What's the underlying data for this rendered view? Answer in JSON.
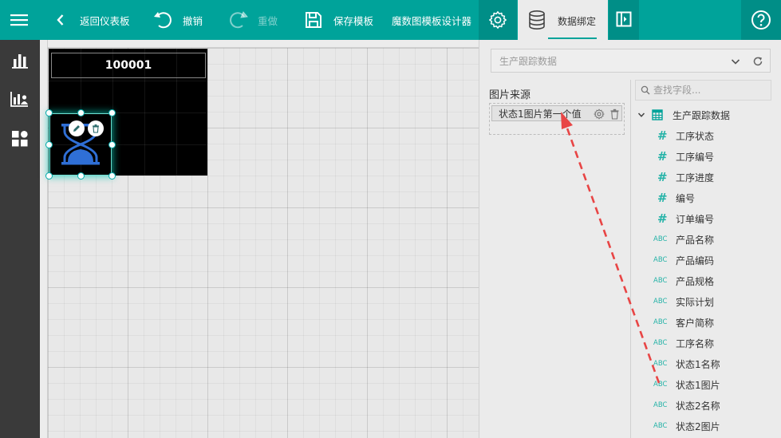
{
  "toolbar": {
    "back_label": "返回仪表板",
    "undo_label": "撤销",
    "redo_label": "重做",
    "save_label": "保存模板",
    "designer_title": "魔数图模板设计器",
    "data_binding_tab": "数据绑定"
  },
  "canvas": {
    "code_text": "100001"
  },
  "panel": {
    "datasource_selected": "生产跟踪数据",
    "image_source_title": "图片来源",
    "bound_field": "状态1图片第一个值",
    "search_placeholder": "查找字段...",
    "tree_root": "生产跟踪数据",
    "fields": [
      {
        "type": "#",
        "name": "工序状态"
      },
      {
        "type": "#",
        "name": "工序编号"
      },
      {
        "type": "#",
        "name": "工序进度"
      },
      {
        "type": "#",
        "name": "编号"
      },
      {
        "type": "#",
        "name": "订单编号"
      },
      {
        "type": "ABC",
        "name": "产品名称"
      },
      {
        "type": "ABC",
        "name": "产品编码"
      },
      {
        "type": "ABC",
        "name": "产品规格"
      },
      {
        "type": "ABC",
        "name": "实际计划"
      },
      {
        "type": "ABC",
        "name": "客户简称"
      },
      {
        "type": "ABC",
        "name": "工序名称"
      },
      {
        "type": "ABC",
        "name": "状态1名称"
      },
      {
        "type": "ABC",
        "name": "状态1图片"
      },
      {
        "type": "ABC",
        "name": "状态2名称"
      },
      {
        "type": "ABC",
        "name": "状态2图片"
      }
    ]
  },
  "colors": {
    "brand": "#00a39a",
    "brand_dark": "#008e87",
    "sidebar": "#3a3a3a",
    "field_type": "#26b3a8",
    "drag_arrow": "#e84545",
    "hourglass": "#2f6fd6"
  }
}
